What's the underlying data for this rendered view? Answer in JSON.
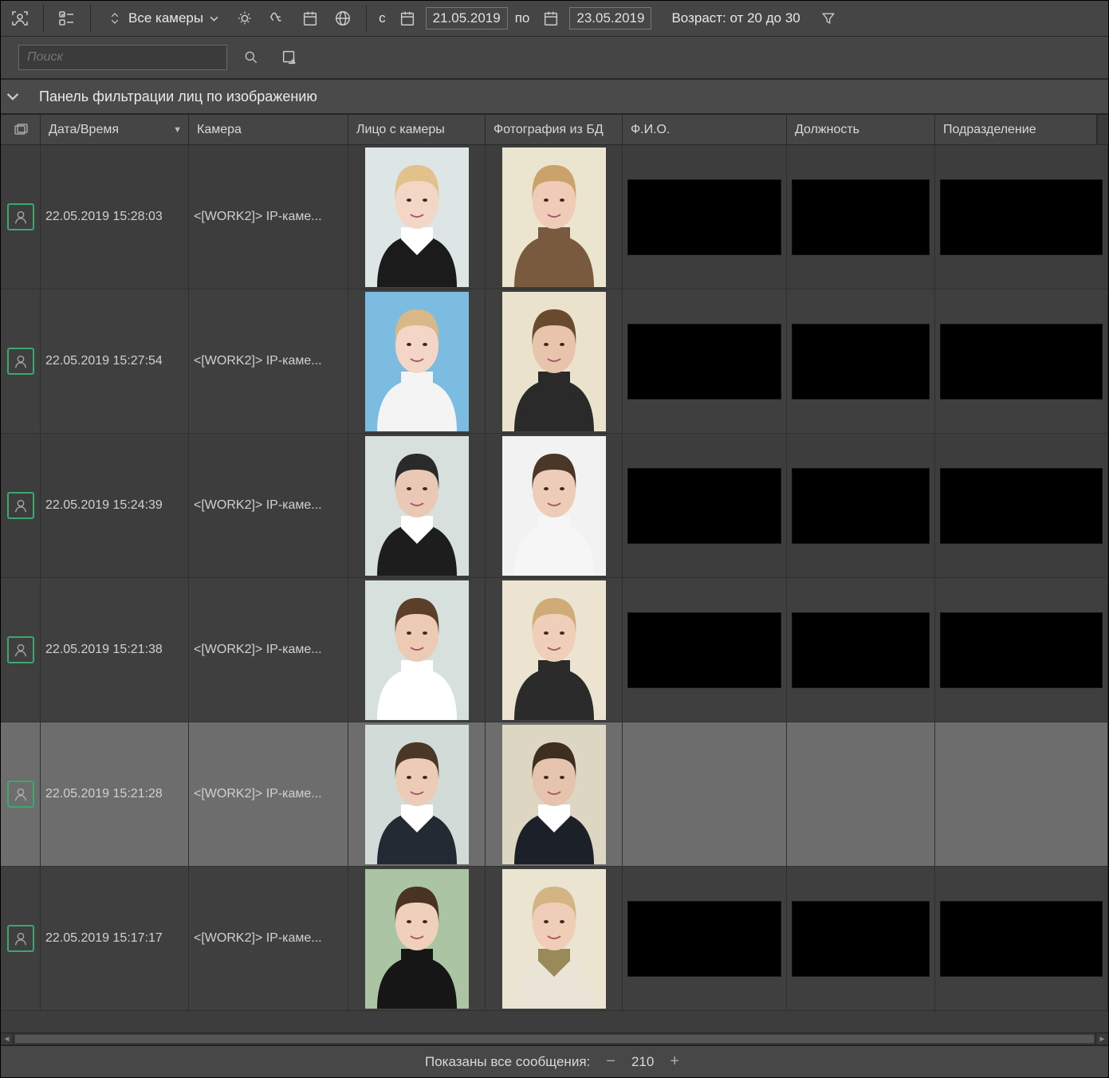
{
  "toolbar": {
    "cameras_label": "Все камеры",
    "date_from_prefix": "с",
    "date_from": "21.05.2019",
    "date_to_prefix": "по",
    "date_to": "23.05.2019",
    "age_label": "Возраст: от 20 до 30",
    "search_placeholder": "Поиск"
  },
  "filter_panel": {
    "title": "Панель фильтрации лиц по изображению"
  },
  "columns": {
    "date": "Дата/Время",
    "camera": "Камера",
    "face": "Лицо с камеры",
    "db_photo": "Фотография из БД",
    "fio": "Ф.И.О.",
    "position": "Должность",
    "department": "Подразделение"
  },
  "rows": [
    {
      "datetime": "22.05.2019 15:28:03",
      "camera": "<[WORK2]> IP-каме...",
      "cam_face": {
        "skin": "#f4d6c6",
        "hair": "#e2c28a",
        "top": "#1b1b1b",
        "collar": "#fff",
        "bg1": "#eaf1f2",
        "bg2": "#cfd9d7"
      },
      "db_face": {
        "skin": "#f0ccb8",
        "hair": "#caa26a",
        "top": "#7a5a3e",
        "collar": "#7a5a3e",
        "bg1": "#f0ead8",
        "bg2": "#e6dec6"
      },
      "selected": false
    },
    {
      "datetime": "22.05.2019 15:27:54",
      "camera": "<[WORK2]> IP-каме...",
      "cam_face": {
        "skin": "#f3d6c6",
        "hair": "#d9b787",
        "top": "#f4f4f4",
        "collar": "#f4f4f4",
        "bg1": "#9fd0ea",
        "bg2": "#5aa8d8"
      },
      "db_face": {
        "skin": "#e9c4ac",
        "hair": "#6a4a2e",
        "top": "#2a2a2a",
        "collar": "#2a2a2a",
        "bg1": "#efe8d5",
        "bg2": "#e5dcc3"
      },
      "selected": false
    },
    {
      "datetime": "22.05.2019 15:24:39",
      "camera": "<[WORK2]> IP-каме...",
      "cam_face": {
        "skin": "#e9c9b6",
        "hair": "#2a2a2a",
        "top": "#1d1d1d",
        "collar": "#fff",
        "bg1": "#e6eceb",
        "bg2": "#c9d3d1"
      },
      "db_face": {
        "skin": "#eecdb8",
        "hair": "#4a3728",
        "top": "#f6f6f6",
        "collar": "#f6f6f6",
        "bg1": "#f7f7f7",
        "bg2": "#ededed"
      },
      "selected": false
    },
    {
      "datetime": "22.05.2019 15:21:38",
      "camera": "<[WORK2]> IP-каме...",
      "cam_face": {
        "skin": "#edcab4",
        "hair": "#5b3f28",
        "top": "#ffffff",
        "collar": "#ffffff",
        "bg1": "#e4ecea",
        "bg2": "#c8d4d0"
      },
      "db_face": {
        "skin": "#f0cfba",
        "hair": "#d0ab78",
        "top": "#2b2b2b",
        "collar": "#2b2b2b",
        "bg1": "#f1eadb",
        "bg2": "#e7dec8"
      },
      "selected": false
    },
    {
      "datetime": "22.05.2019 15:21:28",
      "camera": "<[WORK2]> IP-каме...",
      "cam_face": {
        "skin": "#eccbb7",
        "hair": "#4a3728",
        "top": "#232a34",
        "collar": "#fff",
        "bg1": "#e1e9e7",
        "bg2": "#c2d0cc"
      },
      "db_face": {
        "skin": "#e6c3ad",
        "hair": "#3e2e20",
        "top": "#1c2028",
        "collar": "#fff",
        "bg1": "#e3ddcd",
        "bg2": "#d7cfb9"
      },
      "selected": true
    },
    {
      "datetime": "22.05.2019 15:17:17",
      "camera": "<[WORK2]> IP-каме...",
      "cam_face": {
        "skin": "#f0cfbc",
        "hair": "#4b3324",
        "top": "#161616",
        "collar": "#161616",
        "bg1": "#bcd2b7",
        "bg2": "#98b591"
      },
      "db_face": {
        "skin": "#efcdb6",
        "hair": "#d4b482",
        "top": "#e9e4d6",
        "collar": "#9a8a5a",
        "bg1": "#f0eadb",
        "bg2": "#e6dec8"
      },
      "selected": false
    }
  ],
  "status": {
    "label": "Показаны все сообщения:",
    "count": "210"
  }
}
